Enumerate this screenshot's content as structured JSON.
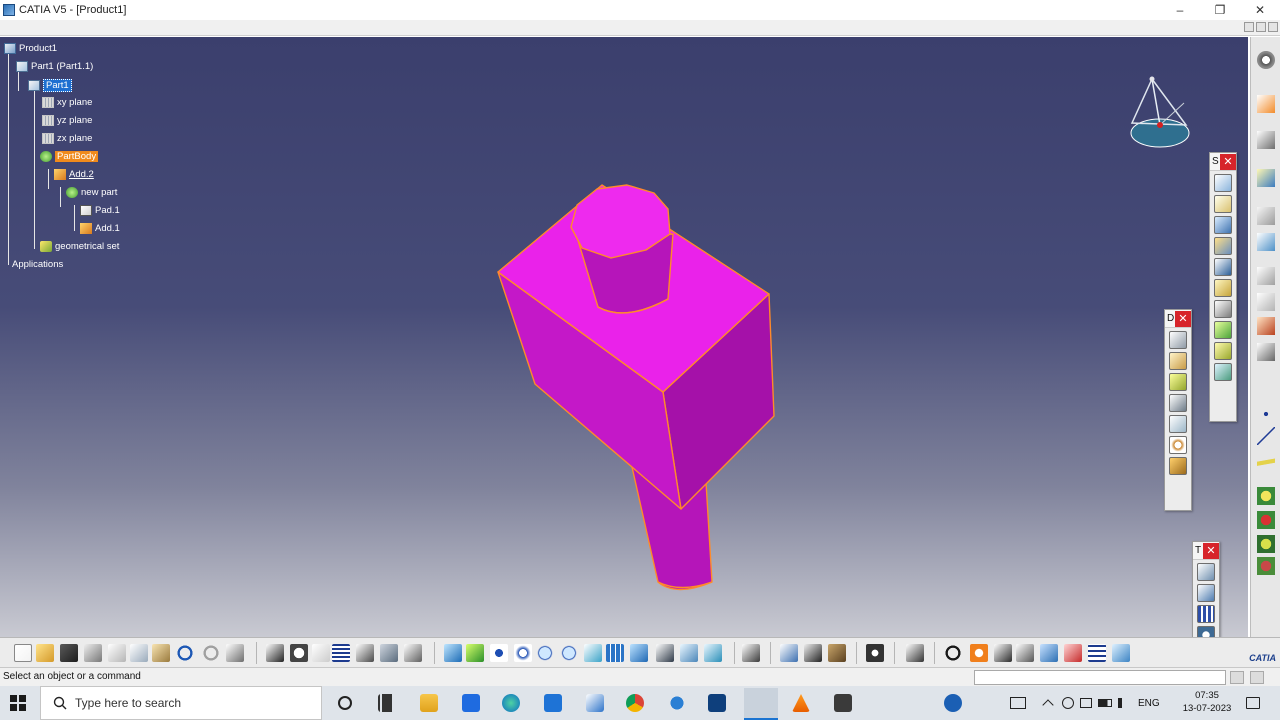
{
  "window": {
    "title": "CATIA V5 - [Product1]",
    "minimize": "–",
    "maximize": "❐",
    "close": "✕"
  },
  "tree": {
    "root": "Product1",
    "part_instance": "Part1 (Part1.1)",
    "part": "Part1",
    "xy": "xy plane",
    "yz": "yz plane",
    "zx": "zx plane",
    "partbody": "PartBody",
    "add2": "Add.2",
    "new_part": "new part",
    "pad1": "Pad.1",
    "add1": "Add.1",
    "geometrical_set": "geometrical set",
    "applications": "Applications"
  },
  "floating_toolbars": {
    "sketch": {
      "label": "S",
      "close": "✕"
    },
    "dress": {
      "label": "D",
      "close": "✕"
    },
    "transform": {
      "label": "T",
      "close": "✕"
    }
  },
  "status": {
    "message": "Select an object or a command"
  },
  "brand": {
    "catia": "CATIA"
  },
  "taskbar": {
    "search_placeholder": "Type here to search",
    "language": "ENG",
    "time": "07:35",
    "date": "13-07-2023"
  },
  "colors": {
    "part": "#e71ee7",
    "edge": "#ff8a2a"
  }
}
